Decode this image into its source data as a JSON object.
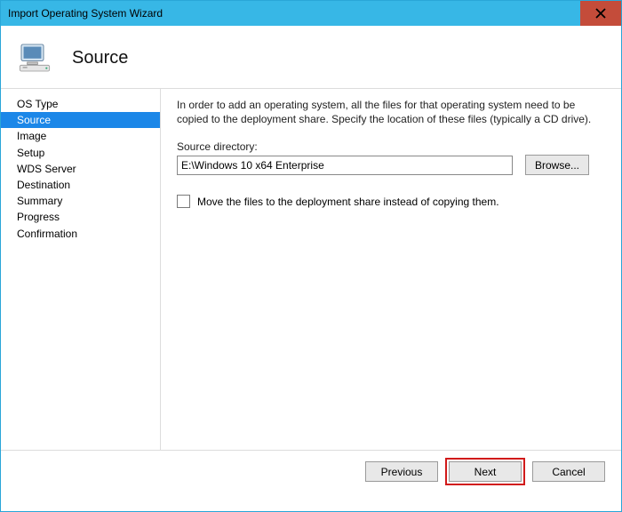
{
  "window": {
    "title": "Import Operating System Wizard"
  },
  "header": {
    "title": "Source"
  },
  "sidebar": {
    "items": [
      {
        "label": "OS Type"
      },
      {
        "label": "Source"
      },
      {
        "label": "Image"
      },
      {
        "label": "Setup"
      },
      {
        "label": "WDS Server"
      },
      {
        "label": "Destination"
      },
      {
        "label": "Summary"
      },
      {
        "label": "Progress"
      },
      {
        "label": "Confirmation"
      }
    ],
    "selected_index": 1
  },
  "main": {
    "instructions": "In order to add an operating system, all the files for that operating system need to be copied to the deployment share.  Specify the location of these files (typically a CD drive).",
    "source_label": "Source directory:",
    "source_value": "E:\\Windows 10 x64 Enterprise",
    "browse_label": "Browse...",
    "move_checkbox_label": "Move the files to the deployment share instead of copying them.",
    "move_checked": false
  },
  "footer": {
    "previous": "Previous",
    "next": "Next",
    "cancel": "Cancel"
  },
  "colors": {
    "accent": "#37b7e6",
    "selection": "#1b87e8",
    "close": "#c44c3a",
    "highlight": "#d11a1a"
  }
}
